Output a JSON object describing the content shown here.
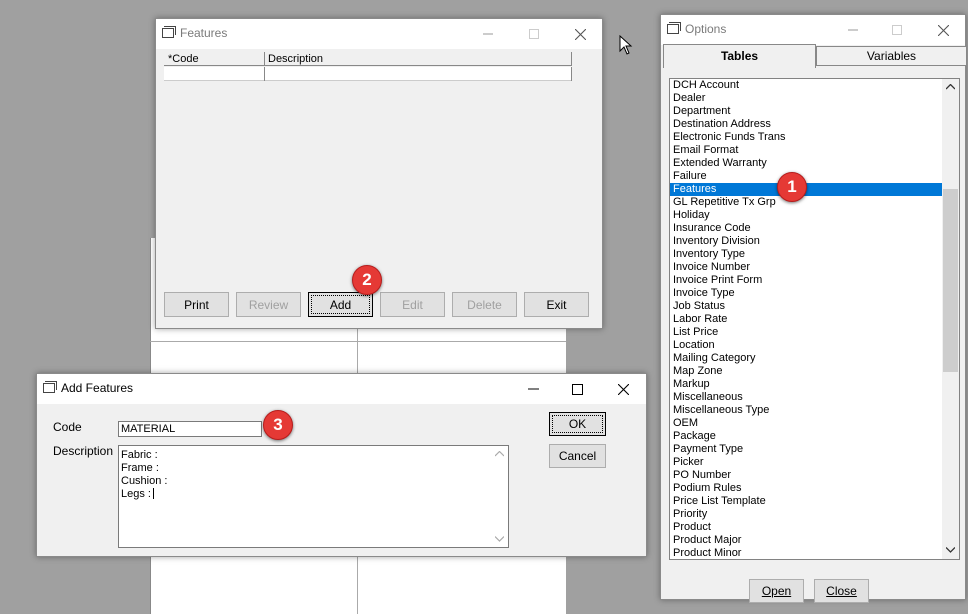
{
  "features_window": {
    "title": "Features",
    "columns": [
      "*Code",
      "Description"
    ],
    "buttons": {
      "print": "Print",
      "review": "Review",
      "add": "Add",
      "edit": "Edit",
      "delete": "Delete",
      "exit": "Exit"
    }
  },
  "options_window": {
    "title": "Options",
    "tabs": {
      "tables": "Tables",
      "variables": "Variables"
    },
    "items": [
      "DCH Account",
      "Dealer",
      "Department",
      "Destination Address",
      "Electronic Funds Trans",
      "Email Format",
      "Extended Warranty",
      "Failure",
      "Features",
      "GL Repetitive Tx Grp",
      "Holiday",
      "Insurance Code",
      "Inventory Division",
      "Inventory Type",
      "Invoice Number",
      "Invoice Print Form",
      "Invoice Type",
      "Job Status",
      "Labor Rate",
      "List Price",
      "Location",
      "Mailing Category",
      "Map Zone",
      "Markup",
      "Miscellaneous",
      "Miscellaneous Type",
      "OEM",
      "Package",
      "Payment Type",
      "Picker",
      "PO Number",
      "Podium Rules",
      "Price List Template",
      "Priority",
      "Product",
      "Product Major",
      "Product Minor"
    ],
    "selected_item": "Features",
    "buttons": {
      "open": "Open",
      "close": "Close"
    }
  },
  "add_window": {
    "title": "Add Features",
    "code_label": "Code",
    "code_value": "MATERIAL",
    "description_label": "Description",
    "description_lines": [
      "Fabric :",
      "Frame :",
      "Cushion :",
      "Legs :"
    ],
    "buttons": {
      "ok": "OK",
      "cancel": "Cancel"
    }
  },
  "badges": [
    "1",
    "2",
    "3"
  ],
  "colors": {
    "selection": "#0078d7",
    "badge": "#e53935"
  }
}
